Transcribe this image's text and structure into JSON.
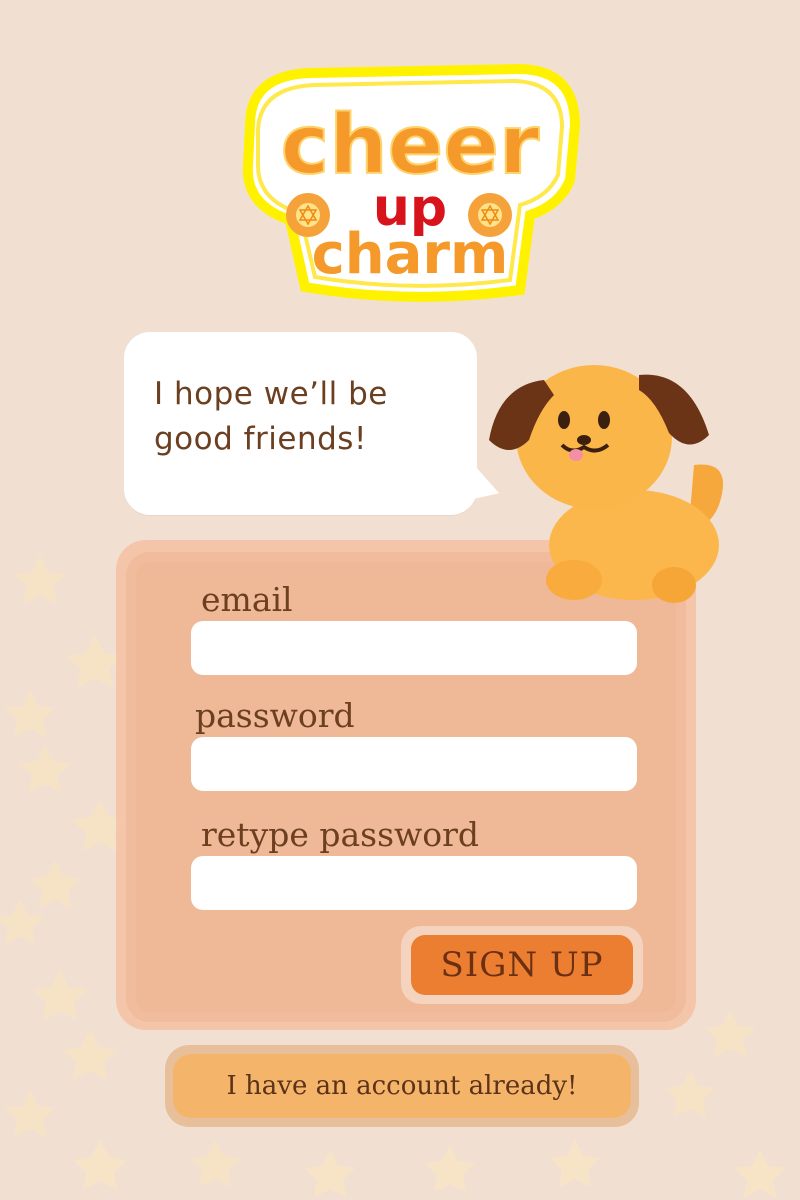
{
  "logo": {
    "line1": "cheer",
    "line2": "up",
    "line3": "charm"
  },
  "speech_bubble": {
    "line1": "I hope we’ll be",
    "line2": "good friends!"
  },
  "form": {
    "email_label": "email",
    "password_label": "password",
    "retype_label": "retype password",
    "email_value": "",
    "password_value": "",
    "retype_value": "",
    "signup_label": "SIGN UP"
  },
  "login_link": "I have an account already!",
  "colors": {
    "background": "#f1e0d2",
    "panel": "#efb896",
    "signup_button": "#ec7e32",
    "login_button": "#f4b56b",
    "text": "#6b3f20",
    "logo_orange": "#f59a2a",
    "logo_red": "#d7141b",
    "logo_yellow": "#fff200"
  },
  "icons": [
    "star-decoration-icon",
    "dog-mascot-icon"
  ]
}
